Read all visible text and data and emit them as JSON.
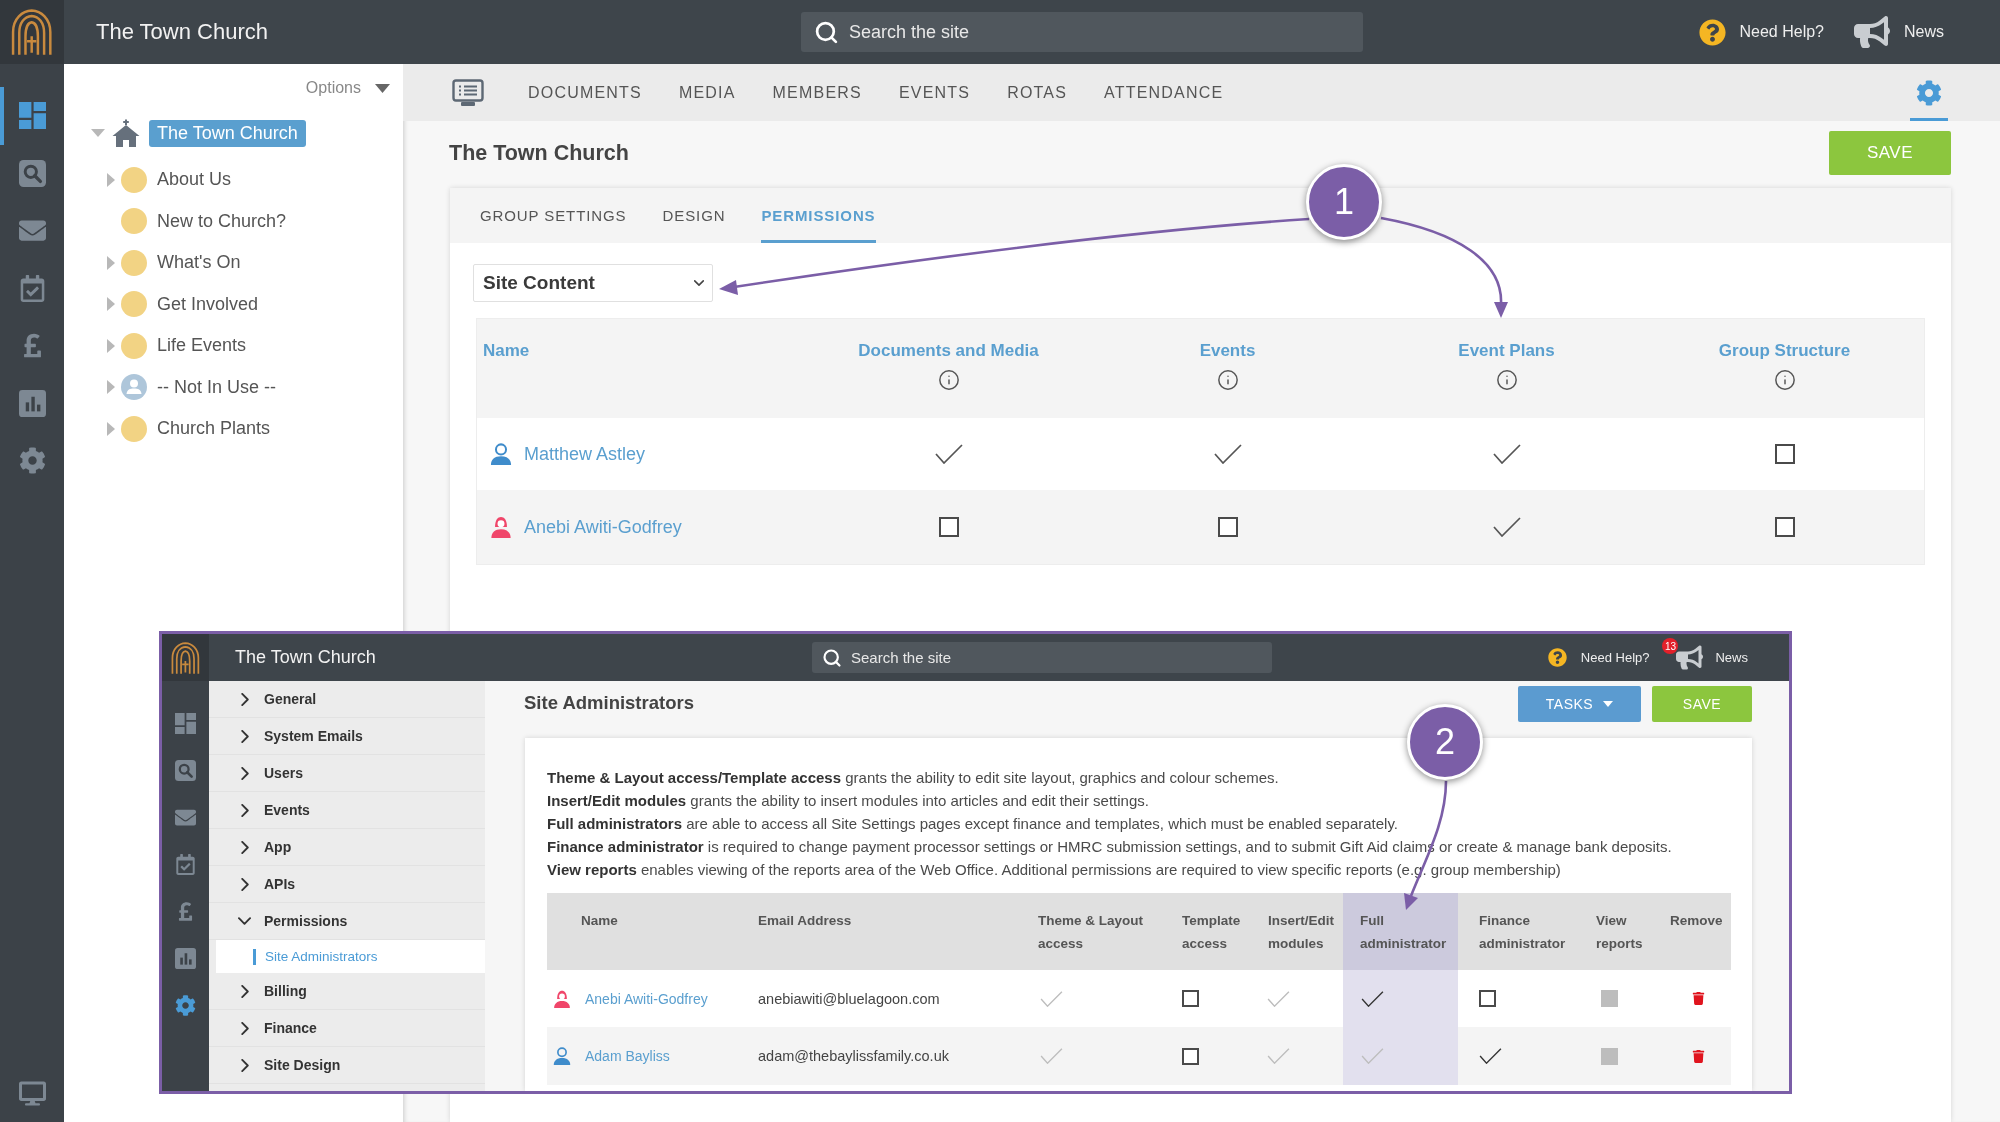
{
  "topbar": {
    "title": "The Town Church",
    "search": {
      "placeholder": "Search the site"
    },
    "help": "Need Help?",
    "news": "News"
  },
  "rail": [
    {
      "kind": "dashboard",
      "selected": true
    },
    {
      "kind": "search",
      "selected": false
    },
    {
      "kind": "mail",
      "selected": false
    },
    {
      "kind": "calendar",
      "selected": false
    },
    {
      "kind": "finance",
      "selected": false
    },
    {
      "kind": "reports",
      "selected": false
    },
    {
      "kind": "settings",
      "selected": false
    },
    {
      "kind": "display",
      "selected": false
    }
  ],
  "tree": {
    "options": "Options",
    "root": {
      "label": "The Town Church",
      "selected": true,
      "expanded": true,
      "children": [
        {
          "label": "About Us",
          "kind": "page",
          "expandable": true,
          "selected": false
        },
        {
          "label": "New to Church?",
          "kind": "page",
          "expandable": false,
          "selected": false
        },
        {
          "label": "What's On",
          "kind": "page",
          "expandable": true,
          "selected": false
        },
        {
          "label": "Get Involved",
          "kind": "page",
          "expandable": true,
          "selected": false
        },
        {
          "label": "Life Events",
          "kind": "page",
          "expandable": true,
          "selected": false
        },
        {
          "label": "-- Not In Use --",
          "kind": "user",
          "expandable": true,
          "selected": false
        },
        {
          "label": "Church Plants",
          "kind": "page",
          "expandable": true,
          "selected": false
        }
      ]
    }
  },
  "nav": {
    "items": [
      {
        "label": "DOCUMENTS",
        "selected": false
      },
      {
        "label": "MEDIA",
        "selected": false
      },
      {
        "label": "MEMBERS",
        "selected": false
      },
      {
        "label": "EVENTS",
        "selected": false
      },
      {
        "label": "ROTAS",
        "selected": false
      },
      {
        "label": "ATTENDANCE",
        "selected": false
      }
    ],
    "settings_selected": true
  },
  "page": {
    "title": "The Town Church",
    "save": "SAVE",
    "tabs": [
      {
        "label": "GROUP SETTINGS",
        "selected": false
      },
      {
        "label": "DESIGN",
        "selected": false
      },
      {
        "label": "PERMISSIONS",
        "selected": true
      }
    ],
    "select": {
      "value": "Site Content"
    },
    "table": {
      "columns": [
        {
          "label": "Name",
          "kind": "name"
        },
        {
          "label": "Documents and Media",
          "kind": "permission"
        },
        {
          "label": "Events",
          "kind": "permission"
        },
        {
          "label": "Event Plans",
          "kind": "permission"
        },
        {
          "label": "Group Structure",
          "kind": "permission"
        }
      ],
      "rows": [
        {
          "name": "Matthew Astley",
          "kind": "male",
          "cells": [
            {
              "checked": true
            },
            {
              "checked": true
            },
            {
              "checked": true
            },
            {
              "checked": false
            }
          ]
        },
        {
          "name": "Anebi Awiti-Godfrey",
          "kind": "female",
          "cells": [
            {
              "checked": false
            },
            {
              "checked": false
            },
            {
              "checked": true
            },
            {
              "checked": false
            }
          ]
        }
      ]
    },
    "callout": "1"
  },
  "inset": {
    "topbar": {
      "title": "The Town Church",
      "search": {
        "placeholder": "Search the site"
      },
      "help": "Need Help?",
      "badge": "13",
      "news": "News"
    },
    "rail": [
      {
        "kind": "dashboard",
        "selected": false
      },
      {
        "kind": "search",
        "selected": false
      },
      {
        "kind": "mail",
        "selected": false
      },
      {
        "kind": "calendar",
        "selected": false
      },
      {
        "kind": "finance",
        "selected": false
      },
      {
        "kind": "reports",
        "selected": false
      },
      {
        "kind": "settings",
        "selected": true
      }
    ],
    "menu": [
      {
        "label": "General",
        "expanded": false
      },
      {
        "label": "System Emails",
        "expanded": false
      },
      {
        "label": "Users",
        "expanded": false
      },
      {
        "label": "Events",
        "expanded": false
      },
      {
        "label": "App",
        "expanded": false
      },
      {
        "label": "APIs",
        "expanded": false
      },
      {
        "label": "Permissions",
        "expanded": true,
        "children": [
          {
            "label": "Site Administrators",
            "selected": true
          }
        ]
      },
      {
        "label": "Billing",
        "expanded": false
      },
      {
        "label": "Finance",
        "expanded": false
      },
      {
        "label": "Site Design",
        "expanded": false
      }
    ],
    "title": "Site Administrators",
    "tasks": "TASKS",
    "save": "SAVE",
    "notes": [
      "**Theme & Layout access/Template access** grants the ability to edit site layout, graphics and colour schemes.",
      "**Insert/Edit modules** grants the ability to insert modules into articles and edit their settings.",
      "**Full administrators** are able to access all Site Settings pages except finance and templates, which must be enabled separately.",
      "**Finance administrator** is required to change payment processor settings or HMRC submission settings, and to submit Gift Aid claims or create & manage bank deposits.",
      "**View reports** enables viewing of the reports area of the Web Office. Additional permissions are required to view specific reports (e.g. group membership)"
    ],
    "table": {
      "columns": [
        {
          "label": "Name",
          "highlighted": false
        },
        {
          "label": "Email Address",
          "highlighted": false
        },
        {
          "label": "Theme & Layout access",
          "highlighted": false
        },
        {
          "label": "Template access",
          "highlighted": false
        },
        {
          "label": "Insert/Edit modules",
          "highlighted": false
        },
        {
          "label": "Full administrator",
          "highlighted": true
        },
        {
          "label": "Finance administrator",
          "highlighted": false
        },
        {
          "label": "View reports",
          "highlighted": false
        },
        {
          "label": "Remove",
          "highlighted": false
        }
      ],
      "rows": [
        {
          "name": "Anebi Awiti-Godfrey",
          "kind": "female",
          "email": "anebiawiti@bluelagoon.com",
          "cells": [
            {
              "checked": true,
              "disabled": true
            },
            {
              "checked": false,
              "disabled": false
            },
            {
              "checked": true,
              "disabled": true
            },
            {
              "checked": true,
              "disabled": false
            },
            {
              "checked": false,
              "disabled": false
            },
            {
              "checked": false,
              "disabled": true
            }
          ]
        },
        {
          "name": "Adam Bayliss",
          "kind": "male",
          "email": "adam@thebaylissfamily.co.uk",
          "cells": [
            {
              "checked": true,
              "disabled": true
            },
            {
              "checked": false,
              "disabled": false
            },
            {
              "checked": true,
              "disabled": true
            },
            {
              "checked": true,
              "disabled": true
            },
            {
              "checked": true,
              "disabled": false
            },
            {
              "checked": false,
              "disabled": true
            }
          ]
        }
      ]
    },
    "callout": "2"
  }
}
